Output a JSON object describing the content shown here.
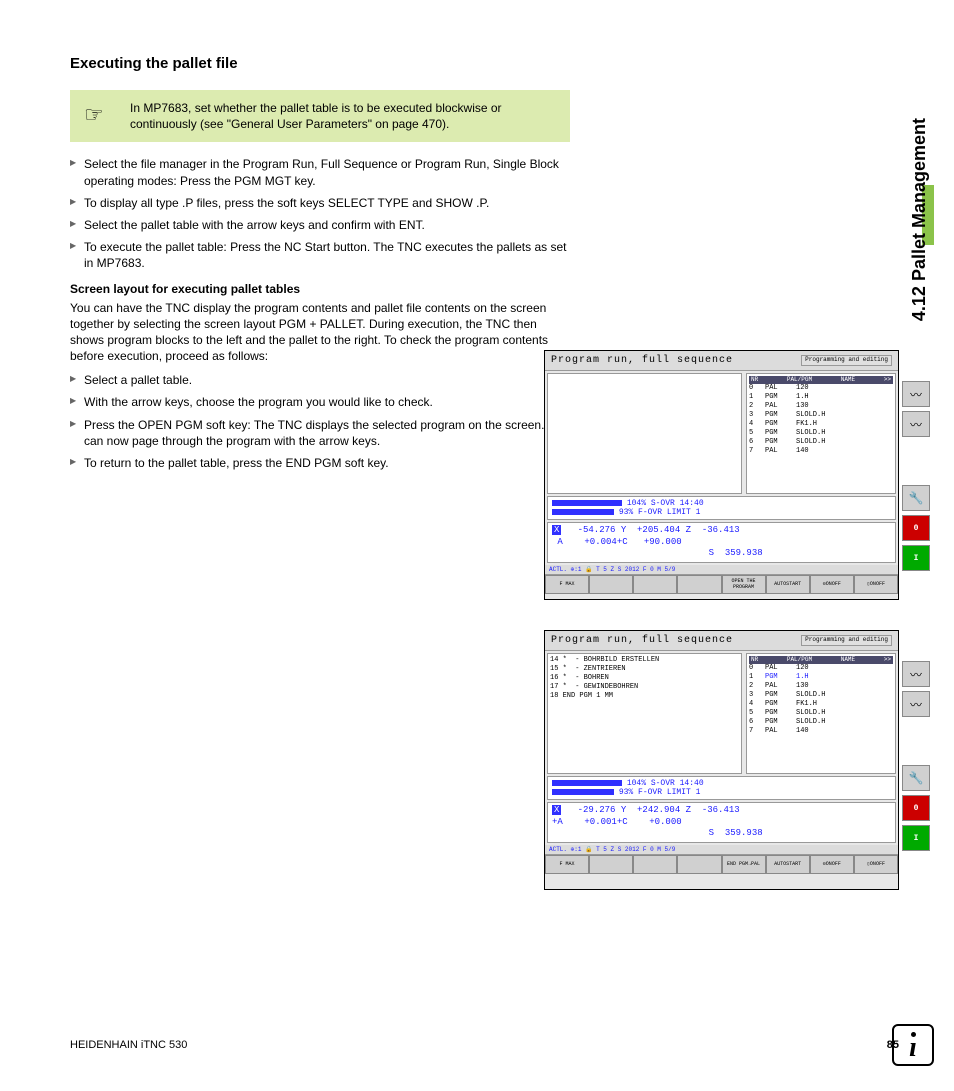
{
  "sideTab": "4.12 Pallet Management",
  "title": "Executing the pallet file",
  "note": "In MP7683, set whether the pallet table is to be executed blockwise or continuously (see \"General User Parameters\" on page 470).",
  "steps1": [
    "Select the file manager in the Program Run, Full Sequence or Program Run, Single Block operating modes: Press the PGM MGT key.",
    "To display all type .P files, press the soft keys SELECT TYPE and SHOW .P.",
    "Select the pallet table with the arrow keys and confirm with ENT.",
    "To execute the pallet table: Press the NC Start button. The TNC executes the pallets as set in MP7683."
  ],
  "subhead": "Screen layout for executing pallet tables",
  "para": "You can have the TNC display the program contents and pallet file contents on the screen together by selecting the screen layout PGM + PALLET. During execution, the TNC then shows program blocks to the left and the pallet to the right. To check the program contents before execution, proceed as follows:",
  "steps2": [
    "Select a pallet table.",
    "With the arrow keys, choose the program you would like to check.",
    "Press the OPEN PGM soft key: The TNC displays the selected program on the screen. You can now page through the program with the arrow keys.",
    "To return to the pallet table, press the END PGM soft key."
  ],
  "screen": {
    "mode": "Program run, full sequence",
    "subMode": "Programming and editing",
    "tableHeader": {
      "l": "NR",
      "m": "PAL/PGM",
      "r": "NAME"
    },
    "table": [
      {
        "n": "0",
        "t": "PAL",
        "v": "120"
      },
      {
        "n": "1",
        "t": "PGM",
        "v": "1.H"
      },
      {
        "n": "2",
        "t": "PAL",
        "v": "130"
      },
      {
        "n": "3",
        "t": "PGM",
        "v": "SLOLD.H"
      },
      {
        "n": "4",
        "t": "PGM",
        "v": "FK1.H"
      },
      {
        "n": "5",
        "t": "PGM",
        "v": "SLOLD.H"
      },
      {
        "n": "6",
        "t": "PGM",
        "v": "SLOLD.H"
      },
      {
        "n": "7",
        "t": "PAL",
        "v": "140"
      }
    ],
    "leftProg": "14 *  - BOHRBILD ERSTELLEN\n15 *  - ZENTRIEREN\n16 *  - BOHREN\n17 *  - GEWINDEBOHREN\n18 END PGM 1 MM",
    "ovr1": "104% S-OVR 14:40",
    "ovr2": " 93% F-OVR LIMIT 1",
    "pos1": {
      "x": "-54.276",
      "y": "+205.404",
      "z": "-36.413",
      "a": "+0.004",
      "c": "+90.000",
      "s": "359.938"
    },
    "pos2": {
      "x": "-29.276",
      "y": "+242.904",
      "z": "-36.413",
      "a": "+0.001",
      "c": "+0.000",
      "s": "359.938"
    },
    "status": "ACTL.      ⊕:1     🔒 T 5      Z S 2012     F 0      M 5/9",
    "softkeys1": {
      "fmax": "F MAX",
      "open": "OPEN THE PROGRAM",
      "auto": "AUTOSTART",
      "on": "ON",
      "off": "OFF"
    },
    "softkeys2": {
      "fmax": "F MAX",
      "end": "END PGM→PAL",
      "auto": "AUTOSTART",
      "on": "ON",
      "off": "OFF"
    }
  },
  "footer": {
    "product": "HEIDENHAIN iTNC 530",
    "page": "85"
  }
}
